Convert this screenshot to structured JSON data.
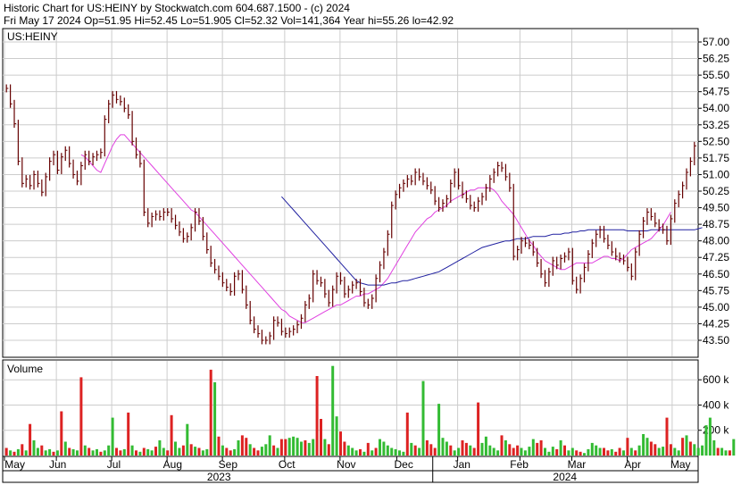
{
  "header": {
    "line1": "Historic Chart for US:HEINY by Stockwatch.com 604.687.1500 - (c) 2024",
    "line2": "Fri May 17 2024   Op=51.95  Hi=52.45  Lo=51.905  Cl=52.32  Vol=141,364  Year hi=55.26  lo=42.92"
  },
  "colors": {
    "up": "#006600",
    "down": "#cc0000",
    "price_bar": "#660000",
    "ma_short": "#e040e0",
    "ma_long": "#2020a0",
    "grid": "#cccccc",
    "vol_up": "#33bb33",
    "vol_down": "#dd2222"
  },
  "chart_data": [
    {
      "type": "ohlc",
      "name": "price",
      "label": "US:HEINY",
      "ylim": [
        42.92,
        57.0
      ],
      "y_ticks": [
        "57.00",
        "56.25",
        "55.50",
        "54.75",
        "54.00",
        "53.25",
        "52.50",
        "51.75",
        "51.00",
        "50.25",
        "49.50",
        "48.75",
        "48.00",
        "47.25",
        "46.50",
        "45.75",
        "45.00",
        "44.25",
        "43.50"
      ],
      "y_tick_values": [
        57.0,
        56.25,
        55.5,
        54.75,
        54.0,
        53.25,
        52.5,
        51.75,
        51.0,
        50.25,
        49.5,
        48.75,
        48.0,
        47.25,
        46.5,
        45.75,
        45.0,
        44.25,
        43.5
      ],
      "x_month_labels": [
        "May",
        "Jun",
        "Jul",
        "Aug",
        "Sep",
        "Oct",
        "Nov",
        "Dec",
        "Jan",
        "Feb",
        "Mar",
        "Apr",
        "May"
      ],
      "x_year_labels": [
        "2023",
        "2024"
      ],
      "closes": [
        54.9,
        54.2,
        53.3,
        51.6,
        50.6,
        50.8,
        50.5,
        51.0,
        50.6,
        50.2,
        50.9,
        51.6,
        51.9,
        51.2,
        51.8,
        52.1,
        51.5,
        51.0,
        50.7,
        51.4,
        51.9,
        51.6,
        51.8,
        51.9,
        52.0,
        53.5,
        54.2,
        54.6,
        54.4,
        54.3,
        54.0,
        53.7,
        52.5,
        51.9,
        51.5,
        49.3,
        48.8,
        49.1,
        49.2,
        49.1,
        49.3,
        49.3,
        49.0,
        48.7,
        48.4,
        48.1,
        48.2,
        48.6,
        49.3,
        48.9,
        48.2,
        47.6,
        47.0,
        46.7,
        46.4,
        46.1,
        45.9,
        45.7,
        46.4,
        46.5,
        45.8,
        45.1,
        44.4,
        44.0,
        43.8,
        43.5,
        43.5,
        43.7,
        44.4,
        44.3,
        43.9,
        43.8,
        43.9,
        44.0,
        44.2,
        44.5,
        45.1,
        45.4,
        46.5,
        46.2,
        46.1,
        45.6,
        45.2,
        45.8,
        46.4,
        46.2,
        45.6,
        45.8,
        46.0,
        46.1,
        45.7,
        45.2,
        45.1,
        45.4,
        46.3,
        46.9,
        47.5,
        48.3,
        49.6,
        50.1,
        50.4,
        50.6,
        50.8,
        50.7,
        51.1,
        50.9,
        50.7,
        50.5,
        50.3,
        49.8,
        49.5,
        49.7,
        49.9,
        50.6,
        51.1,
        50.5,
        50.1,
        49.9,
        49.6,
        49.5,
        49.8,
        50.0,
        50.4,
        50.8,
        51.1,
        51.4,
        51.3,
        50.9,
        50.4,
        47.3,
        47.6,
        48.0,
        47.9,
        47.8,
        47.5,
        47.0,
        46.5,
        46.1,
        46.6,
        47.1,
        46.9,
        47.2,
        47.3,
        47.5,
        46.2,
        45.8,
        46.3,
        46.8,
        47.4,
        47.9,
        48.3,
        48.5,
        48.1,
        47.8,
        47.5,
        47.3,
        47.2,
        47.1,
        46.8,
        46.4,
        47.5,
        48.3,
        48.9,
        49.3,
        49.1,
        48.8,
        48.6,
        48.5,
        48.0,
        49.0,
        49.7,
        50.1,
        50.5,
        51.1,
        51.6,
        52.3
      ],
      "ma_short": {
        "name": "",
        "values": [
          null,
          null,
          null,
          null,
          null,
          null,
          null,
          null,
          null,
          null,
          null,
          null,
          null,
          null,
          null,
          null,
          null,
          null,
          null,
          51.9,
          51.8,
          51.6,
          51.4,
          51.2,
          51.1,
          51.5,
          51.9,
          52.3,
          52.6,
          52.8,
          52.8,
          52.6,
          52.4,
          52.2,
          52.0,
          51.8,
          51.6,
          51.4,
          51.2,
          51.0,
          50.8,
          50.6,
          50.4,
          50.2,
          50.0,
          49.8,
          49.6,
          49.4,
          49.3,
          49.1,
          48.9,
          48.7,
          48.5,
          48.3,
          48.1,
          47.9,
          47.7,
          47.5,
          47.3,
          47.1,
          46.9,
          46.7,
          46.5,
          46.3,
          46.1,
          45.9,
          45.7,
          45.5,
          45.3,
          45.1,
          44.9,
          44.8,
          44.6,
          44.5,
          44.4,
          44.3,
          44.3,
          44.4,
          44.5,
          44.6,
          44.7,
          44.8,
          44.9,
          45.0,
          45.1,
          45.1,
          45.2,
          45.3,
          45.4,
          45.5,
          45.5,
          45.6,
          45.6,
          45.7,
          45.8,
          45.9,
          46.1,
          46.3,
          46.6,
          46.9,
          47.2,
          47.5,
          47.8,
          48.1,
          48.4,
          48.6,
          48.8,
          49.0,
          49.1,
          49.3,
          49.4,
          49.5,
          49.6,
          49.8,
          49.9,
          50.0,
          50.1,
          50.2,
          50.3,
          50.3,
          50.4,
          50.4,
          50.4,
          50.4,
          50.3,
          50.1,
          49.8,
          49.6,
          49.4,
          49.2,
          48.9,
          48.6,
          48.3,
          48.0,
          47.8,
          47.5,
          47.3,
          47.1,
          47.0,
          46.9,
          46.8,
          46.7,
          46.7,
          46.8,
          46.9,
          47.0,
          47.0,
          47.0,
          47.0,
          47.0,
          47.1,
          47.2,
          47.3,
          47.3,
          47.2,
          47.2,
          47.1,
          47.2,
          47.4,
          47.6,
          47.7,
          47.8,
          47.9,
          48.0,
          48.1,
          48.3,
          48.5,
          48.7,
          49.0,
          49.3
        ],
        "color_key": "ma_short"
      },
      "ma_long": {
        "name": "",
        "values": [
          null,
          null,
          null,
          null,
          null,
          null,
          null,
          null,
          null,
          null,
          null,
          null,
          null,
          null,
          null,
          null,
          null,
          null,
          null,
          null,
          null,
          null,
          null,
          null,
          null,
          null,
          null,
          null,
          null,
          null,
          null,
          null,
          null,
          null,
          null,
          null,
          null,
          null,
          null,
          null,
          null,
          null,
          null,
          null,
          null,
          null,
          null,
          null,
          null,
          null,
          null,
          null,
          null,
          null,
          null,
          null,
          null,
          null,
          null,
          null,
          null,
          null,
          null,
          null,
          null,
          null,
          null,
          null,
          null,
          null,
          50.0,
          49.8,
          49.6,
          49.4,
          49.2,
          49.0,
          48.8,
          48.6,
          48.4,
          48.2,
          48.0,
          47.8,
          47.6,
          47.4,
          47.2,
          47.0,
          46.8,
          46.6,
          46.4,
          46.2,
          46.1,
          46.05,
          46.0,
          46.0,
          46.0,
          46.0,
          46.0,
          46.05,
          46.1,
          46.1,
          46.15,
          46.2,
          46.2,
          46.25,
          46.3,
          46.35,
          46.4,
          46.45,
          46.5,
          46.55,
          46.6,
          46.7,
          46.8,
          46.9,
          47.0,
          47.1,
          47.2,
          47.3,
          47.4,
          47.5,
          47.6,
          47.7,
          47.75,
          47.8,
          47.85,
          47.9,
          47.95,
          48.0,
          48.0,
          48.05,
          48.1,
          48.1,
          48.1,
          48.15,
          48.2,
          48.2,
          48.2,
          48.2,
          48.25,
          48.3,
          48.3,
          48.3,
          48.35,
          48.35,
          48.4,
          48.4,
          48.45,
          48.45,
          48.5,
          48.5,
          48.5,
          48.5,
          48.5,
          48.5,
          48.5,
          48.5,
          48.5,
          48.5,
          48.45,
          48.45,
          48.45,
          48.45,
          48.45,
          48.45,
          48.5,
          48.5,
          48.5,
          48.5,
          48.5,
          48.5,
          48.5,
          48.5,
          48.5,
          48.5,
          48.5,
          48.5,
          48.55,
          48.6
        ],
        "color_key": "ma_long"
      }
    },
    {
      "type": "bar",
      "name": "volume",
      "label": "Volume",
      "ylim": [
        0,
        750000
      ],
      "y_ticks": [
        "600 k",
        "400 k",
        "200 k"
      ],
      "y_tick_values": [
        600000,
        400000,
        200000
      ],
      "values": [
        60000,
        40000,
        30000,
        50000,
        90000,
        40000,
        250000,
        120000,
        60000,
        80000,
        40000,
        50000,
        30000,
        40000,
        350000,
        110000,
        60000,
        50000,
        40000,
        620000,
        80000,
        60000,
        40000,
        50000,
        30000,
        40000,
        80000,
        300000,
        60000,
        40000,
        50000,
        340000,
        80000,
        40000,
        30000,
        60000,
        50000,
        40000,
        70000,
        120000,
        60000,
        40000,
        320000,
        110000,
        60000,
        80000,
        250000,
        90000,
        70000,
        60000,
        40000,
        50000,
        680000,
        580000,
        150000,
        80000,
        60000,
        40000,
        50000,
        120000,
        160000,
        140000,
        90000,
        60000,
        40000,
        70000,
        90000,
        160000,
        80000,
        60000,
        130000,
        130000,
        140000,
        150000,
        140000,
        110000,
        120000,
        100000,
        130000,
        630000,
        290000,
        130000,
        90000,
        710000,
        310000,
        190000,
        110000,
        80000,
        60000,
        40000,
        50000,
        30000,
        100000,
        40000,
        60000,
        130000,
        110000,
        80000,
        60000,
        50000,
        40000,
        30000,
        340000,
        100000,
        80000,
        60000,
        590000,
        120000,
        90000,
        60000,
        410000,
        140000,
        110000,
        80000,
        40000,
        60000,
        120000,
        100000,
        80000,
        60000,
        420000,
        100000,
        150000,
        80000,
        60000,
        40000,
        160000,
        120000,
        90000,
        60000,
        80000,
        60000,
        40000,
        70000,
        130000,
        100000,
        120000,
        60000,
        30000,
        70000,
        50000,
        120000,
        80000,
        40000,
        60000,
        40000,
        30000,
        20000,
        50000,
        100000,
        80000,
        60000,
        60000,
        40000,
        50000,
        30000,
        60000,
        40000,
        140000,
        60000,
        40000,
        80000,
        170000,
        140000,
        110000,
        90000,
        60000,
        70000,
        300000,
        90000,
        60000,
        40000,
        140000,
        160000,
        110000,
        90000,
        60000,
        80000,
        240000,
        300000,
        120000,
        60000,
        60000,
        40000,
        40000,
        130000
      ],
      "up_flags": [
        0,
        1,
        0,
        1,
        0,
        1,
        0,
        1,
        1,
        0,
        1,
        1,
        0,
        1,
        0,
        1,
        0,
        1,
        1,
        0,
        1,
        0,
        1,
        1,
        0,
        1,
        1,
        1,
        0,
        0,
        1,
        0,
        1,
        0,
        1,
        0,
        1,
        1,
        0,
        1,
        1,
        0,
        0,
        1,
        1,
        0,
        1,
        0,
        1,
        0,
        1,
        1,
        0,
        1,
        0,
        1,
        0,
        0,
        1,
        1,
        0,
        0,
        1,
        0,
        0,
        1,
        1,
        1,
        0,
        1,
        0,
        0,
        1,
        1,
        1,
        1,
        0,
        1,
        1,
        0,
        0,
        1,
        0,
        1,
        1,
        0,
        0,
        1,
        1,
        1,
        0,
        1,
        0,
        1,
        0,
        1,
        1,
        1,
        1,
        1,
        1,
        1,
        0,
        1,
        0,
        1,
        1,
        0,
        0,
        0,
        1,
        1,
        1,
        0,
        1,
        1,
        0,
        0,
        1,
        0,
        0,
        1,
        1,
        1,
        1,
        1,
        0,
        1,
        0,
        0,
        0,
        1,
        1,
        1,
        1,
        0,
        0,
        1,
        1,
        1,
        0,
        1,
        0,
        1,
        1,
        0,
        0,
        1,
        1,
        1,
        1,
        1,
        0,
        0,
        1,
        0,
        0,
        1,
        0,
        1,
        0,
        1,
        1,
        1,
        0,
        0,
        1,
        1,
        0,
        0,
        1,
        1,
        0,
        1,
        0,
        1,
        1,
        1,
        1,
        1,
        1,
        0,
        1,
        1,
        0,
        1,
        1
      ]
    }
  ]
}
